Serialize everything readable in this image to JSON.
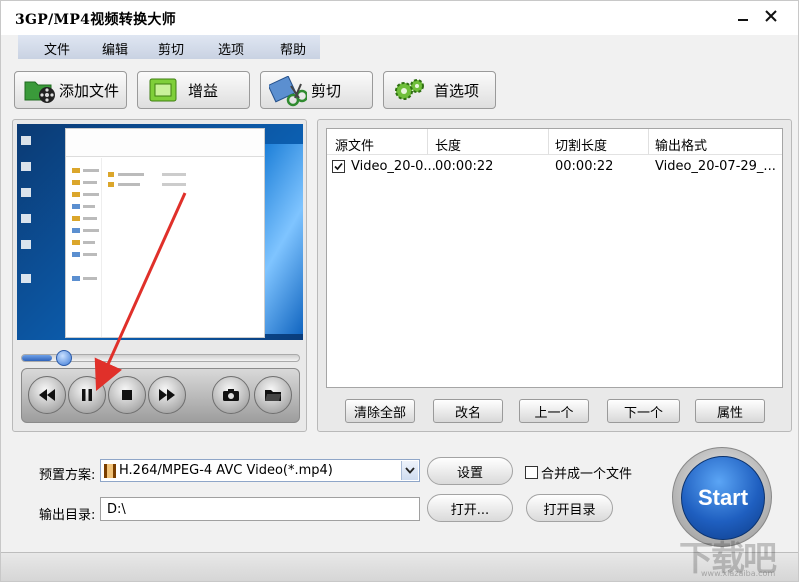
{
  "window": {
    "title": "3GP/MP4视频转换大师"
  },
  "menu": [
    "文件",
    "编辑",
    "剪切",
    "选项",
    "帮助"
  ],
  "toolbar": {
    "add_file": "添加文件",
    "gain": "增益",
    "cut": "剪切",
    "preferences": "首选项"
  },
  "player": {
    "progress_percent": 11,
    "controls": [
      "rewind-icon",
      "pause-icon",
      "stop-icon",
      "fast-forward-icon",
      "camera-icon",
      "folder-icon"
    ]
  },
  "file_list": {
    "columns": [
      "源文件",
      "长度",
      "切割长度",
      "输出格式"
    ],
    "rows": [
      {
        "checked": true,
        "source": "Video_20-0...",
        "length": "00:00:22",
        "cut_length": "00:00:22",
        "output": "Video_20-07-29_..."
      }
    ],
    "buttons": {
      "clear_all": "清除全部",
      "rename": "改名",
      "up": "上一个",
      "down": "下一个",
      "properties": "属性"
    }
  },
  "settings": {
    "preset_label": "预置方案:",
    "preset_value": "H.264/MPEG-4 AVC Video(*.mp4)",
    "settings_button": "设置",
    "merge_label": "合并成一个文件",
    "merge_checked": false,
    "output_label": "输出目录:",
    "output_value": "D:\\",
    "open_button": "打开...",
    "open_dir_button": "打开目录"
  },
  "start_label": "Start",
  "watermark": {
    "main": "下载吧",
    "sub": "www.xiazaiba.com"
  },
  "colors": {
    "accent_blue": "#1f5fc0",
    "arrow_red": "#e0302a",
    "menu_bg": "#c9d2e2"
  }
}
